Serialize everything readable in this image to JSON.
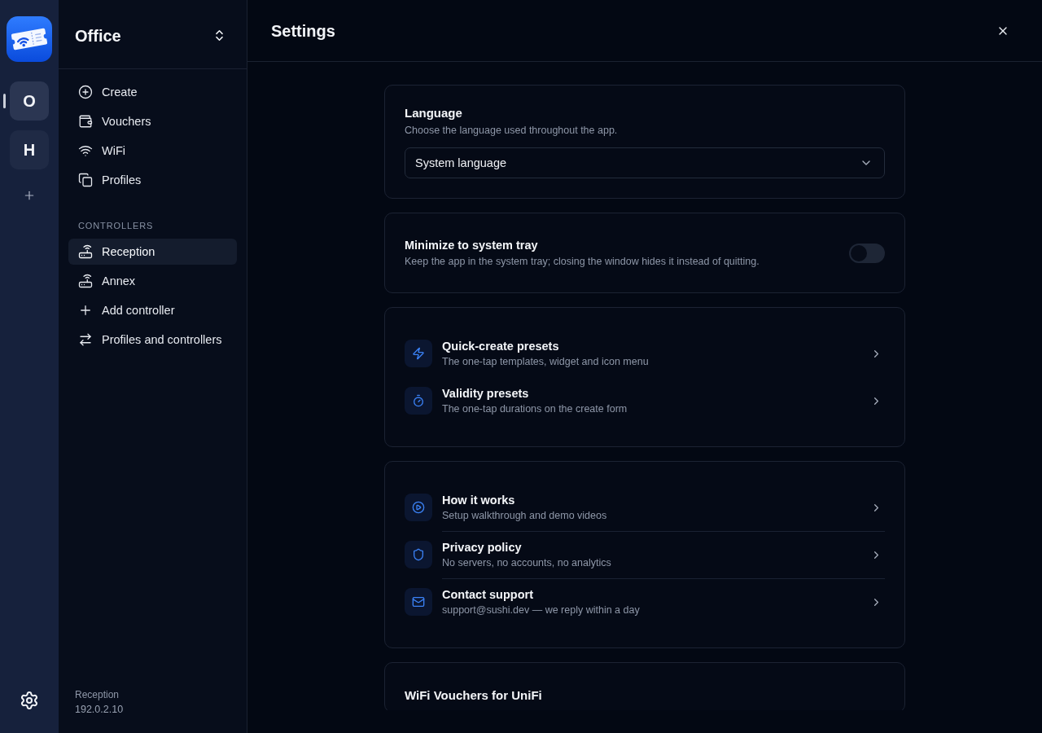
{
  "rail": {
    "workspaces": [
      {
        "initial": "O",
        "selected": true
      },
      {
        "initial": "H",
        "selected": false
      }
    ]
  },
  "sidebar": {
    "workspace_name": "Office",
    "nav_items": [
      {
        "label": "Create",
        "selected": false
      },
      {
        "label": "Vouchers",
        "selected": false
      },
      {
        "label": "WiFi",
        "selected": false
      },
      {
        "label": "Profiles",
        "selected": false
      }
    ],
    "controllers": {
      "heading": "CONTROLLERS",
      "items": [
        {
          "kind": "controller",
          "label": "Reception",
          "selected": true
        },
        {
          "kind": "controller",
          "label": "Annex",
          "selected": false
        },
        {
          "kind": "add",
          "label": "Add controller",
          "selected": false
        },
        {
          "kind": "manage",
          "label": "Profiles and controllers",
          "selected": false
        }
      ]
    },
    "footer": {
      "controller_name": "Reception",
      "address": "192.0.2.10"
    }
  },
  "page": {
    "title": "Settings"
  },
  "sections": [
    {
      "kind": "select",
      "title": "Language",
      "description": "Choose the language used throughout the app.",
      "value": "System language"
    },
    {
      "kind": "toggle",
      "title": "Minimize to system tray",
      "description": "Keep the app in the system tray; closing the window hides it instead of quitting.",
      "on": false
    },
    {
      "kind": "links",
      "dividers": false,
      "rows": [
        {
          "title": "Quick-create presets",
          "subtitle": "The one-tap templates, widget and icon menu"
        },
        {
          "title": "Validity presets",
          "subtitle": "The one-tap durations on the create form"
        }
      ]
    },
    {
      "kind": "links",
      "dividers": true,
      "rows": [
        {
          "title": "How it works",
          "subtitle": "Setup walkthrough and demo videos"
        },
        {
          "title": "Privacy policy",
          "subtitle": "No servers, no accounts, no analytics"
        },
        {
          "title": "Contact support",
          "subtitle": "support@sushi.dev — we reply within a day"
        }
      ]
    },
    {
      "kind": "about",
      "title": "WiFi Vouchers for UniFi"
    }
  ]
}
